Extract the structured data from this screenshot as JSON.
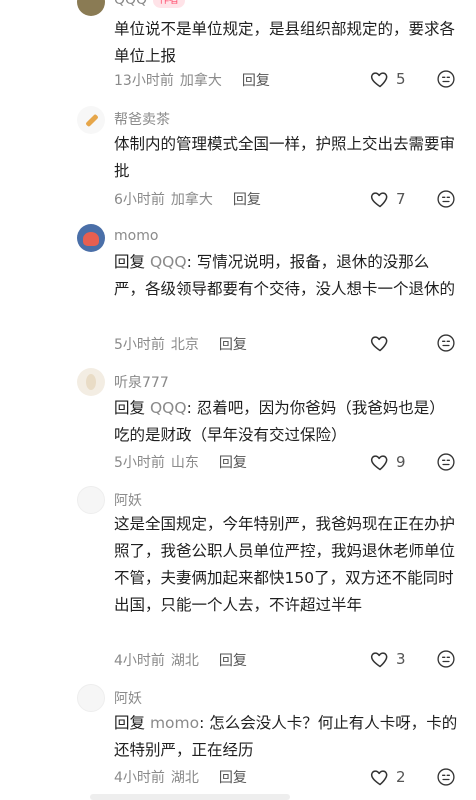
{
  "comments": [
    {
      "name": "QQQ",
      "tag": "作者",
      "text": "单位说不是单位规定，是县组织部规定的，要求各单位上报",
      "time": "13小时前",
      "location": "加拿大",
      "reply_label": "回复",
      "likes": "5",
      "avatar": "dark"
    },
    {
      "name": "帮爸卖茶",
      "text": "体制内的管理模式全国一样，护照上交出去需要审批",
      "time": "6小时前",
      "location": "加拿大",
      "reply_label": "回复",
      "likes": "7",
      "avatar": "pencil"
    },
    {
      "name": "momo",
      "reply_prefix": "回复",
      "reply_target": "QQQ",
      "text": ": 写情况说明，报备，退休的没那么严，各级领导都要有个交待，没人想卡一个退休的",
      "time": "5小时前",
      "location": "北京",
      "reply_label": "回复",
      "likes": "",
      "avatar": "pic"
    },
    {
      "name": "听泉777",
      "reply_prefix": "回复",
      "reply_target": "QQQ",
      "text": ": 忍着吧，因为你爸妈（我爸妈也是）吃的是财政（早年没有交过保险）",
      "time": "5小时前",
      "location": "山东",
      "reply_label": "回复",
      "likes": "9",
      "avatar": "cream"
    },
    {
      "name": "阿妖",
      "text": "这是全国规定，今年特别严，我爸妈现在正在办护照了，我爸公职人员单位严控，我妈退休老师单位不管，夫妻俩加起来都快150了，双方还不能同时出国，只能一个人去，不许超过半年",
      "time": "4小时前",
      "location": "湖北",
      "reply_label": "回复",
      "likes": "3",
      "avatar": "blank"
    },
    {
      "name": "阿妖",
      "reply_prefix": "回复",
      "reply_target": "momo",
      "text": ": 怎么会没人卡？何止有人卡呀，卡的还特别严，正在经历",
      "time": "4小时前",
      "location": "湖北",
      "reply_label": "回复",
      "likes": "2",
      "avatar": "blank"
    }
  ],
  "colors": {
    "accent_tag": "#ff4d6d",
    "meta": "#8a8a8a",
    "text": "#1f1f1f"
  },
  "icons": {
    "like": "heart-outline-icon",
    "more": "emoji-face-icon"
  }
}
